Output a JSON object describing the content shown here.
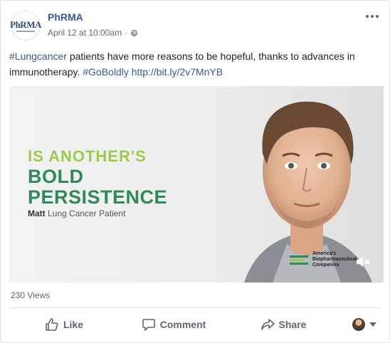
{
  "post": {
    "page_name": "PhRMA",
    "timestamp": "April 12 at 10:00am",
    "separator": "·",
    "avatar_logo": "PhRMA",
    "text": {
      "hashtag1": "#Lungcancer",
      "body": " patients have more reasons to be hopeful, thanks to advances in immunotherapy. ",
      "hashtag2": "#GoBoldly",
      "link": "http://bit.ly/2v7MnYB"
    }
  },
  "media": {
    "line1": "IS ANOTHER'S",
    "line2": "BOLD",
    "line3": "PERSISTENCE",
    "caption_name": "Matt",
    "caption_desc": " Lung Cancer Patient",
    "badge_line1": "America's",
    "badge_line2": "Biopharmaceutical",
    "badge_line3": "Companies"
  },
  "stats": {
    "views": "230 Views"
  },
  "actions": {
    "like": "Like",
    "comment": "Comment",
    "share": "Share"
  },
  "colors": {
    "link": "#385898",
    "green_light": "#9ccb4c",
    "green_dark": "#2e8b57"
  },
  "icons": [
    "globe-icon",
    "more-options-icon",
    "like-icon",
    "comment-icon",
    "share-icon",
    "mute-icon",
    "caret-down-icon"
  ]
}
